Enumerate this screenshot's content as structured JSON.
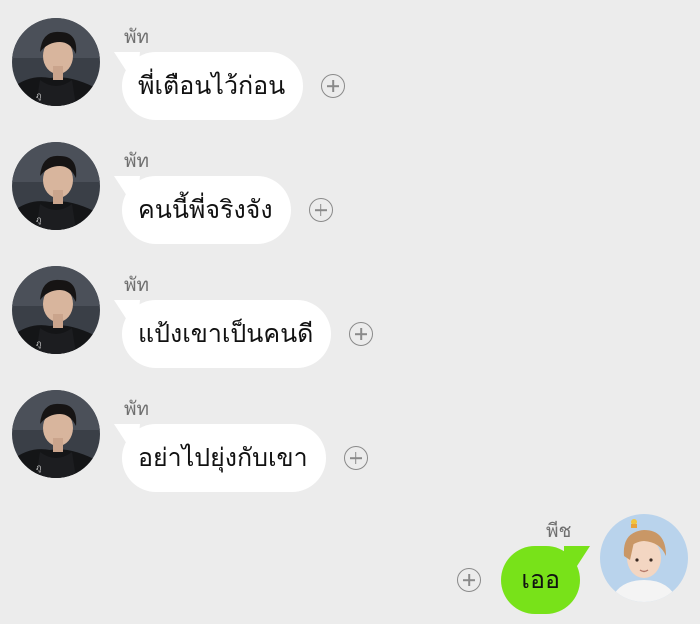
{
  "contact": {
    "name": "พัท",
    "avatar_icon": "dark-hoodie-portrait-avatar"
  },
  "me": {
    "name": "พีช",
    "avatar_icon": "light-portrait-avatar"
  },
  "colors": {
    "background": "#ececec",
    "incoming_bubble": "#ffffff",
    "outgoing_bubble": "#78e219"
  },
  "messages": [
    {
      "sender": "พัท",
      "text": "พี่เตือนไว้ก่อน",
      "direction": "incoming"
    },
    {
      "sender": "พัท",
      "text": "คนนี้พี่จริงจัง",
      "direction": "incoming"
    },
    {
      "sender": "พัท",
      "text": "แป้งเขาเป็นคนดี",
      "direction": "incoming"
    },
    {
      "sender": "พัท",
      "text": "อย่าไปยุ่งกับเขา",
      "direction": "incoming"
    },
    {
      "sender": "พีช",
      "text": "เออ",
      "direction": "outgoing"
    }
  ]
}
